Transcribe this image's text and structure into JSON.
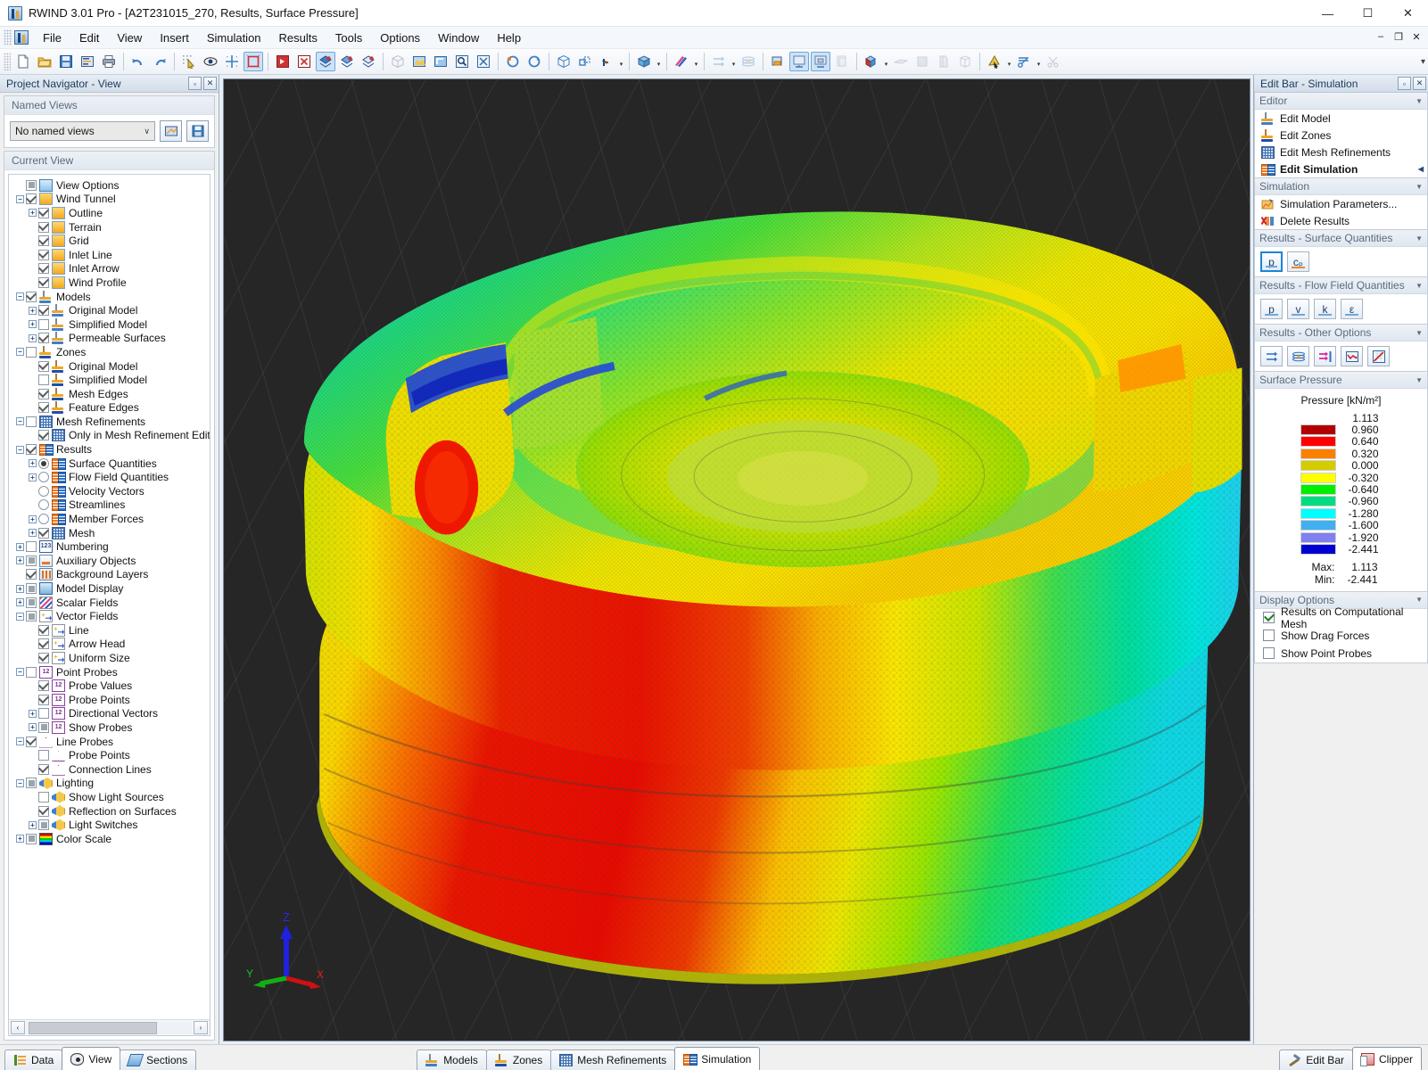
{
  "window": {
    "title": "RWIND 3.01 Pro - [A2T231015_270, Results, Surface Pressure]",
    "minimize": "—",
    "maximize": "☐",
    "close": "✕",
    "mdi_minimize": "–",
    "mdi_restore": "❐",
    "mdi_close": "✕"
  },
  "menubar": {
    "items": [
      "File",
      "Edit",
      "View",
      "Insert",
      "Simulation",
      "Results",
      "Tools",
      "Options",
      "Window",
      "Help"
    ]
  },
  "toolbar": {
    "groups": [
      {
        "buttons": [
          "new-file",
          "open-folder",
          "save",
          "save-as-report",
          "print"
        ]
      },
      {
        "buttons": [
          "undo",
          "redo"
        ]
      },
      {
        "buttons": [
          "select-objects",
          "view-visibility",
          "snap-grid",
          "selection-box"
        ]
      },
      {
        "buttons": [
          "show-model-solid",
          "hide-model",
          "render-mode-1",
          "render-mode-2",
          "render-mode-3"
        ]
      },
      {
        "buttons": [
          "isometric-view",
          "shade-view",
          "perspective",
          "zoom-window",
          "zoom-all"
        ]
      },
      {
        "buttons": [
          "rotate-left",
          "rotate-right"
        ]
      },
      {
        "buttons": [
          "wireframe-cube",
          "move-object",
          "axis-colors"
        ]
      },
      {
        "buttons": [
          "solid-cube",
          "scalar-field"
        ]
      },
      {
        "buttons": [
          "vector-arrows",
          "streamlines-layers"
        ]
      },
      {
        "buttons": [
          "results-surface",
          "results-model",
          "results-zones",
          "copy-view"
        ]
      },
      {
        "buttons": [
          "clipper-cube",
          "slice-plane",
          "solid-plane",
          "section-plane",
          "mesh-cube"
        ]
      },
      {
        "buttons": [
          "pick-tool",
          "cut-tool",
          "scissors-tool"
        ]
      }
    ]
  },
  "left_panel": {
    "caption": "Project Navigator - View",
    "pin_label": "▫",
    "close_label": "✕",
    "named_views": {
      "title": "Named Views",
      "selected": "No named views",
      "caret": "∨"
    },
    "current_view": {
      "title": "Current View"
    },
    "tree": [
      {
        "label": "View Options",
        "indent": 0,
        "exp": "none",
        "ctl": "cb-part",
        "icon": "ic-view"
      },
      {
        "label": "Wind Tunnel",
        "indent": 0,
        "exp": "minus",
        "ctl": "cb-on",
        "icon": "ic-cube"
      },
      {
        "label": "Outline",
        "indent": 1,
        "exp": "plus",
        "ctl": "cb-on",
        "icon": "ic-cube"
      },
      {
        "label": "Terrain",
        "indent": 1,
        "exp": "none",
        "ctl": "cb-on",
        "icon": "ic-cube"
      },
      {
        "label": "Grid",
        "indent": 1,
        "exp": "none",
        "ctl": "cb-on",
        "icon": "ic-cube"
      },
      {
        "label": "Inlet Line",
        "indent": 1,
        "exp": "none",
        "ctl": "cb-on",
        "icon": "ic-cube"
      },
      {
        "label": "Inlet Arrow",
        "indent": 1,
        "exp": "none",
        "ctl": "cb-on",
        "icon": "ic-cube"
      },
      {
        "label": "Wind Profile",
        "indent": 1,
        "exp": "none",
        "ctl": "cb-on",
        "icon": "ic-cube"
      },
      {
        "label": "Models",
        "indent": 0,
        "exp": "minus",
        "ctl": "cb-on",
        "icon": "ic-model"
      },
      {
        "label": "Original Model",
        "indent": 1,
        "exp": "plus",
        "ctl": "cb-on",
        "icon": "ic-model"
      },
      {
        "label": "Simplified Model",
        "indent": 1,
        "exp": "plus",
        "ctl": "cb-off",
        "icon": "ic-model"
      },
      {
        "label": "Permeable Surfaces",
        "indent": 1,
        "exp": "plus",
        "ctl": "cb-on",
        "icon": "ic-model"
      },
      {
        "label": "Zones",
        "indent": 0,
        "exp": "minus",
        "ctl": "cb-off",
        "icon": "ic-zone"
      },
      {
        "label": "Original Model",
        "indent": 1,
        "exp": "none",
        "ctl": "cb-on",
        "icon": "ic-zone"
      },
      {
        "label": "Simplified Model",
        "indent": 1,
        "exp": "none",
        "ctl": "cb-off",
        "icon": "ic-zone"
      },
      {
        "label": "Mesh Edges",
        "indent": 1,
        "exp": "none",
        "ctl": "cb-on",
        "icon": "ic-zone"
      },
      {
        "label": "Feature Edges",
        "indent": 1,
        "exp": "none",
        "ctl": "cb-on",
        "icon": "ic-zone"
      },
      {
        "label": "Mesh Refinements",
        "indent": 0,
        "exp": "minus",
        "ctl": "cb-off",
        "icon": "ic-grid"
      },
      {
        "label": "Only in Mesh Refinement Edito",
        "indent": 1,
        "exp": "none",
        "ctl": "cb-on",
        "icon": "ic-grid"
      },
      {
        "label": "Results",
        "indent": 0,
        "exp": "minus",
        "ctl": "cb-on",
        "icon": "ic-results"
      },
      {
        "label": "Surface Quantities",
        "indent": 1,
        "exp": "plus",
        "ctl": "radio-on",
        "icon": "ic-results"
      },
      {
        "label": "Flow Field Quantities",
        "indent": 1,
        "exp": "plus",
        "ctl": "radio-off",
        "icon": "ic-results"
      },
      {
        "label": "Velocity Vectors",
        "indent": 1,
        "exp": "none",
        "ctl": "radio-off",
        "icon": "ic-results"
      },
      {
        "label": "Streamlines",
        "indent": 1,
        "exp": "none",
        "ctl": "radio-off",
        "icon": "ic-results"
      },
      {
        "label": "Member Forces",
        "indent": 1,
        "exp": "plus",
        "ctl": "radio-off",
        "icon": "ic-results"
      },
      {
        "label": "Mesh",
        "indent": 1,
        "exp": "plus",
        "ctl": "cb-on",
        "icon": "ic-grid"
      },
      {
        "label": "Numbering",
        "indent": 0,
        "exp": "plus",
        "ctl": "cb-off",
        "icon": "ic-123",
        "glyph": "123"
      },
      {
        "label": "Auxiliary Objects",
        "indent": 0,
        "exp": "plus",
        "ctl": "cb-part",
        "icon": "ic-aux"
      },
      {
        "label": "Background Layers",
        "indent": 0,
        "exp": "none",
        "ctl": "cb-on",
        "icon": "ic-bg"
      },
      {
        "label": "Model Display",
        "indent": 0,
        "exp": "plus",
        "ctl": "cb-part",
        "icon": "ic-md"
      },
      {
        "label": "Scalar Fields",
        "indent": 0,
        "exp": "plus",
        "ctl": "cb-part",
        "icon": "ic-scalar"
      },
      {
        "label": "Vector Fields",
        "indent": 0,
        "exp": "minus",
        "ctl": "cb-part",
        "icon": "ic-vec"
      },
      {
        "label": "Line",
        "indent": 1,
        "exp": "none",
        "ctl": "cb-on",
        "icon": "ic-vec"
      },
      {
        "label": "Arrow Head",
        "indent": 1,
        "exp": "none",
        "ctl": "cb-on",
        "icon": "ic-vec"
      },
      {
        "label": "Uniform Size",
        "indent": 1,
        "exp": "none",
        "ctl": "cb-on",
        "icon": "ic-vec"
      },
      {
        "label": "Point Probes",
        "indent": 0,
        "exp": "minus",
        "ctl": "cb-off",
        "icon": "ic-probe",
        "glyph": "12"
      },
      {
        "label": "Probe Values",
        "indent": 1,
        "exp": "none",
        "ctl": "cb-on",
        "icon": "ic-probe",
        "glyph": "12"
      },
      {
        "label": "Probe Points",
        "indent": 1,
        "exp": "none",
        "ctl": "cb-on",
        "icon": "ic-probe",
        "glyph": "12"
      },
      {
        "label": "Directional Vectors",
        "indent": 1,
        "exp": "plus",
        "ctl": "cb-off",
        "icon": "ic-probe",
        "glyph": "12"
      },
      {
        "label": "Show Probes",
        "indent": 1,
        "exp": "plus",
        "ctl": "cb-part",
        "icon": "ic-probe",
        "glyph": "12"
      },
      {
        "label": "Line Probes",
        "indent": 0,
        "exp": "minus",
        "ctl": "cb-on",
        "icon": "ic-lineprobe"
      },
      {
        "label": "Probe Points",
        "indent": 1,
        "exp": "none",
        "ctl": "cb-off",
        "icon": "ic-lineprobe"
      },
      {
        "label": "Connection Lines",
        "indent": 1,
        "exp": "none",
        "ctl": "cb-on",
        "icon": "ic-lineprobe"
      },
      {
        "label": "Lighting",
        "indent": 0,
        "exp": "minus",
        "ctl": "cb-part",
        "icon": "ic-light"
      },
      {
        "label": "Show Light Sources",
        "indent": 1,
        "exp": "none",
        "ctl": "cb-off",
        "icon": "ic-light"
      },
      {
        "label": "Reflection on Surfaces",
        "indent": 1,
        "exp": "none",
        "ctl": "cb-on",
        "icon": "ic-light"
      },
      {
        "label": "Light Switches",
        "indent": 1,
        "exp": "plus",
        "ctl": "cb-part",
        "icon": "ic-light"
      },
      {
        "label": "Color Scale",
        "indent": 0,
        "exp": "plus",
        "ctl": "cb-part",
        "icon": "ic-colorscale"
      }
    ],
    "hscroll": {
      "left": "‹",
      "right": "›"
    }
  },
  "right_panel": {
    "caption": "Edit Bar - Simulation",
    "pin_label": "▫",
    "close_label": "✕",
    "editor": {
      "title": "Editor",
      "caret": "▼",
      "items": [
        {
          "label": "Edit Model",
          "icon": "ic-model",
          "bold": false
        },
        {
          "label": "Edit Zones",
          "icon": "ic-zone",
          "bold": false
        },
        {
          "label": "Edit Mesh Refinements",
          "icon": "ic-grid",
          "bold": false
        },
        {
          "label": "Edit Simulation",
          "icon": "ic-results",
          "bold": true,
          "marker": "◀"
        }
      ]
    },
    "simulation": {
      "title": "Simulation",
      "caret": "▼",
      "items": [
        {
          "label": "Simulation Parameters...",
          "icon": "ic-params"
        },
        {
          "label": "Delete Results",
          "icon": "ic-delete"
        }
      ]
    },
    "surface_quantities": {
      "title": "Results - Surface Quantities",
      "caret": "▼",
      "buttons": [
        {
          "label": "p",
          "selected": true,
          "underline": "blue"
        },
        {
          "label": "cₚ",
          "selected": false,
          "underline": "orange"
        }
      ]
    },
    "flow_field_quantities": {
      "title": "Results - Flow Field Quantities",
      "caret": "▼",
      "buttons": [
        {
          "label": "p",
          "selected": false,
          "underline": "blue"
        },
        {
          "label": "v",
          "selected": false,
          "underline": "blue"
        },
        {
          "label": "k",
          "selected": false,
          "underline": "blue"
        },
        {
          "label": "ε",
          "selected": false,
          "underline": "blue"
        }
      ]
    },
    "other_options": {
      "title": "Results - Other Options",
      "caret": "▼",
      "buttons": [
        "flow-arrows-icon",
        "iso-surface-icon",
        "flow-to-line-icon",
        "diagram-icon",
        "chart-icon"
      ]
    },
    "surface_pressure": {
      "title": "Surface Pressure",
      "caret": "▼",
      "legend_title": "Pressure [kN/m²]",
      "max_label": "Max:",
      "min_label": "Min:",
      "max_value": "1.113",
      "min_value": "-2.441"
    },
    "display_options": {
      "title": "Display Options",
      "caret": "▼",
      "items": [
        {
          "label": "Results on Computational Mesh",
          "checked": true
        },
        {
          "label": "Show Drag Forces",
          "checked": false
        },
        {
          "label": "Show Point Probes",
          "checked": false
        }
      ]
    }
  },
  "chart_data": {
    "type": "bar",
    "title": "Pressure [kN/m²]",
    "ylabel": "Pressure [kN/m²]",
    "legend_position": "right-panel",
    "categories": [
      "1.113",
      "0.960",
      "0.640",
      "0.320",
      "0.000",
      "-0.320",
      "-0.640",
      "-0.960",
      "-1.280",
      "-1.600",
      "-1.920",
      "-2.441"
    ],
    "values": [
      1.113,
      0.96,
      0.64,
      0.32,
      0.0,
      -0.32,
      -0.64,
      -0.96,
      -1.28,
      -1.6,
      -1.92,
      -2.441
    ],
    "swatch_colors": [
      "#b30000",
      "#fe0000",
      "#fb8000",
      "#d4cc00",
      "#ffff00",
      "#00ee00",
      "#00dd80",
      "#00ffff",
      "#40b0f0",
      "#8080f0",
      "#0000d0"
    ],
    "ylim": [
      -2.441,
      1.113
    ],
    "max": 1.113,
    "min": -2.441,
    "units": "kN/m²"
  },
  "viewport": {
    "axis": {
      "x": "X",
      "y": "Y",
      "z": "Z",
      "x_color": "#e02020",
      "y_color": "#20c020",
      "z_color": "#2020e0"
    },
    "background": "#262626"
  },
  "bottom_tabs": {
    "left": [
      {
        "label": "Data",
        "icon": "ic-data",
        "active": false
      },
      {
        "label": "View",
        "icon": "ic-eye",
        "active": true
      },
      {
        "label": "Sections",
        "icon": "ic-sections",
        "active": false
      }
    ],
    "center": [
      {
        "label": "Models",
        "icon": "ic-model",
        "active": false
      },
      {
        "label": "Zones",
        "icon": "ic-zone",
        "active": false
      },
      {
        "label": "Mesh Refinements",
        "icon": "ic-grid",
        "active": false
      },
      {
        "label": "Simulation",
        "icon": "ic-results",
        "active": true
      }
    ],
    "right": [
      {
        "label": "Edit Bar",
        "icon": "ic-editbar",
        "active": false
      },
      {
        "label": "Clipper",
        "icon": "ic-clipper",
        "active": true
      }
    ]
  }
}
